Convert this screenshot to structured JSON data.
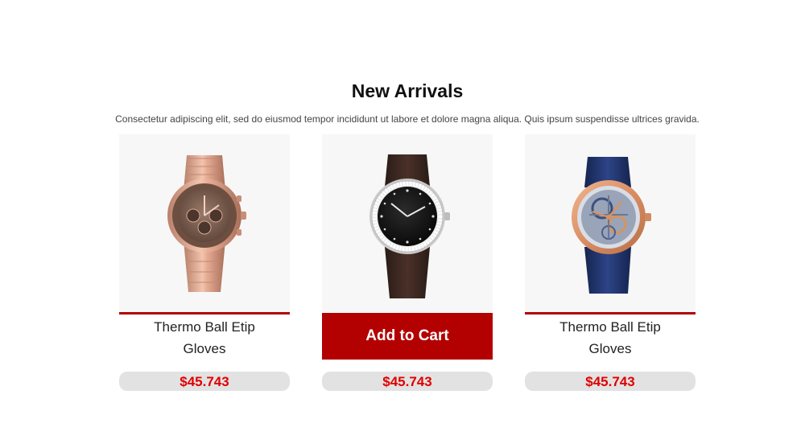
{
  "section": {
    "title": "New Arrivals",
    "subtitle": "Consectetur adipiscing elit, sed do eiusmod tempor incididunt ut labore et dolore magna aliqua. Quis ipsum suspendisse ultrices gravida."
  },
  "products": [
    {
      "name_line1": "Thermo Ball Etip",
      "name_line2": "Gloves",
      "price": "$45.743",
      "image": "rose-gold-chronograph-watch"
    },
    {
      "add_to_cart": "Add to Cart",
      "price": "$45.743",
      "image": "black-dial-diamond-bezel-watch"
    },
    {
      "name_line1": "Thermo Ball Etip",
      "name_line2": "Gloves",
      "price": "$45.743",
      "image": "skeleton-tourbillon-blue-strap-watch"
    }
  ],
  "colors": {
    "accent_red": "#b30000",
    "price_red": "#e00000",
    "price_bg": "#e2e2e2"
  }
}
